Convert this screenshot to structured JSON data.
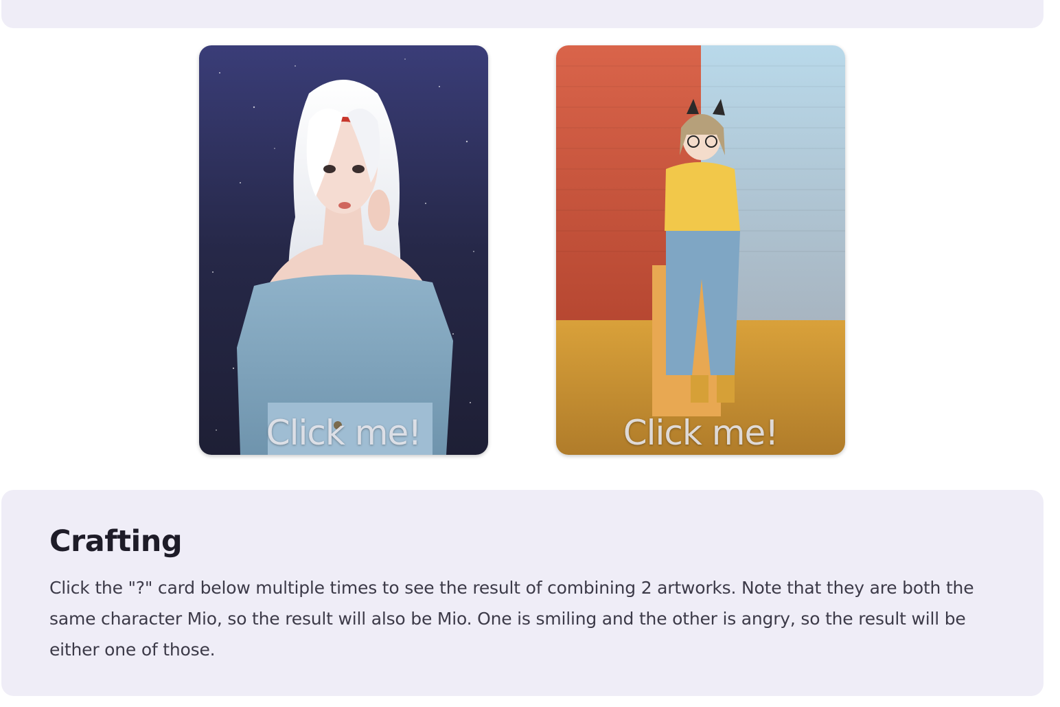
{
  "cards": [
    {
      "label": "Click me!",
      "art_icon": "white-haired-girl-artwork"
    },
    {
      "label": "Click me!",
      "art_icon": "cat-ear-girl-artwork"
    }
  ],
  "crafting": {
    "title": "Crafting",
    "description": "Click the \"?\" card below multiple times to see the result of combining 2 artworks. Note that they are both the same character Mio, so the result will also be Mio. One is smiling and the other is angry, so the result will be either one of those."
  },
  "colors": {
    "panel_bg": "#efedf7",
    "title_text": "#1e1c28",
    "body_text": "#3c3a48"
  }
}
